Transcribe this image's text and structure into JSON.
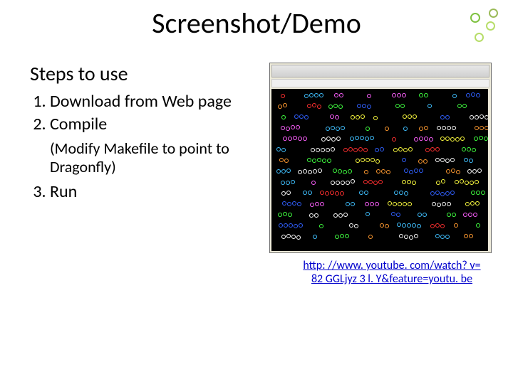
{
  "title": "Screenshot/Demo",
  "subhead": "Steps to use",
  "steps": {
    "s1": "Download from Web page",
    "s2": "Compile",
    "note": "(Modify Makefile to point to Dragonfly)",
    "s3": "Run"
  },
  "link": {
    "line1": "http: //www. youtube. com/watch? v=",
    "line2": "82 GGLjyz 3 l. Y&feature=youtu. be"
  },
  "deco_colors": {
    "a": "#9bbb59",
    "b": "#7fc241",
    "c": "#b7dd69"
  },
  "shot": {
    "palette": [
      "#ff3030",
      "#ffff40",
      "#40ff40",
      "#40c0ff",
      "#ff60ff",
      "#ff9a30",
      "#ffffff",
      "#3060ff"
    ],
    "rows": 14,
    "cluster_min": 1,
    "cluster_max": 5
  }
}
